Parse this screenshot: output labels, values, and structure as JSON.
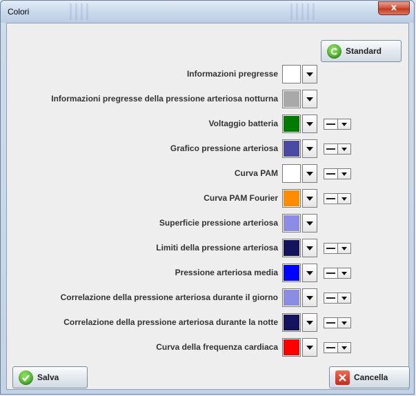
{
  "window": {
    "title": "Colori",
    "close_label": "x"
  },
  "buttons": {
    "standard": "Standard",
    "save": "Salva",
    "cancel": "Cancella"
  },
  "rows": [
    {
      "label": "Informazioni pregresse",
      "color": "#ffffff",
      "has_line_style": false
    },
    {
      "label": "Informazioni pregresse della pressione arteriosa notturna",
      "color": "#a9a9a9",
      "has_line_style": false
    },
    {
      "label": "Voltaggio batteria",
      "color": "#007b00",
      "has_line_style": true
    },
    {
      "label": "Grafico pressione arteriosa",
      "color": "#4a4aa4",
      "has_line_style": true
    },
    {
      "label": "Curva PAM",
      "color": "#ffffff",
      "has_line_style": true
    },
    {
      "label": "Curva PAM Fourier",
      "color": "#ff8c00",
      "has_line_style": true
    },
    {
      "label": "Superficie pressione arteriosa",
      "color": "#8c8ce6",
      "has_line_style": false
    },
    {
      "label": "Limiti della pressione arteriosa",
      "color": "#14145e",
      "has_line_style": true
    },
    {
      "label": "Pressione arteriosa media",
      "color": "#0000ff",
      "has_line_style": true
    },
    {
      "label": "Correlazione della pressione arteriosa durante il giorno",
      "color": "#8c8ce6",
      "has_line_style": true
    },
    {
      "label": "Correlazione della pressione arteriosa durante la notte",
      "color": "#14145e",
      "has_line_style": true
    },
    {
      "label": "Curva della frequenza cardiaca",
      "color": "#ff0000",
      "has_line_style": true
    }
  ]
}
